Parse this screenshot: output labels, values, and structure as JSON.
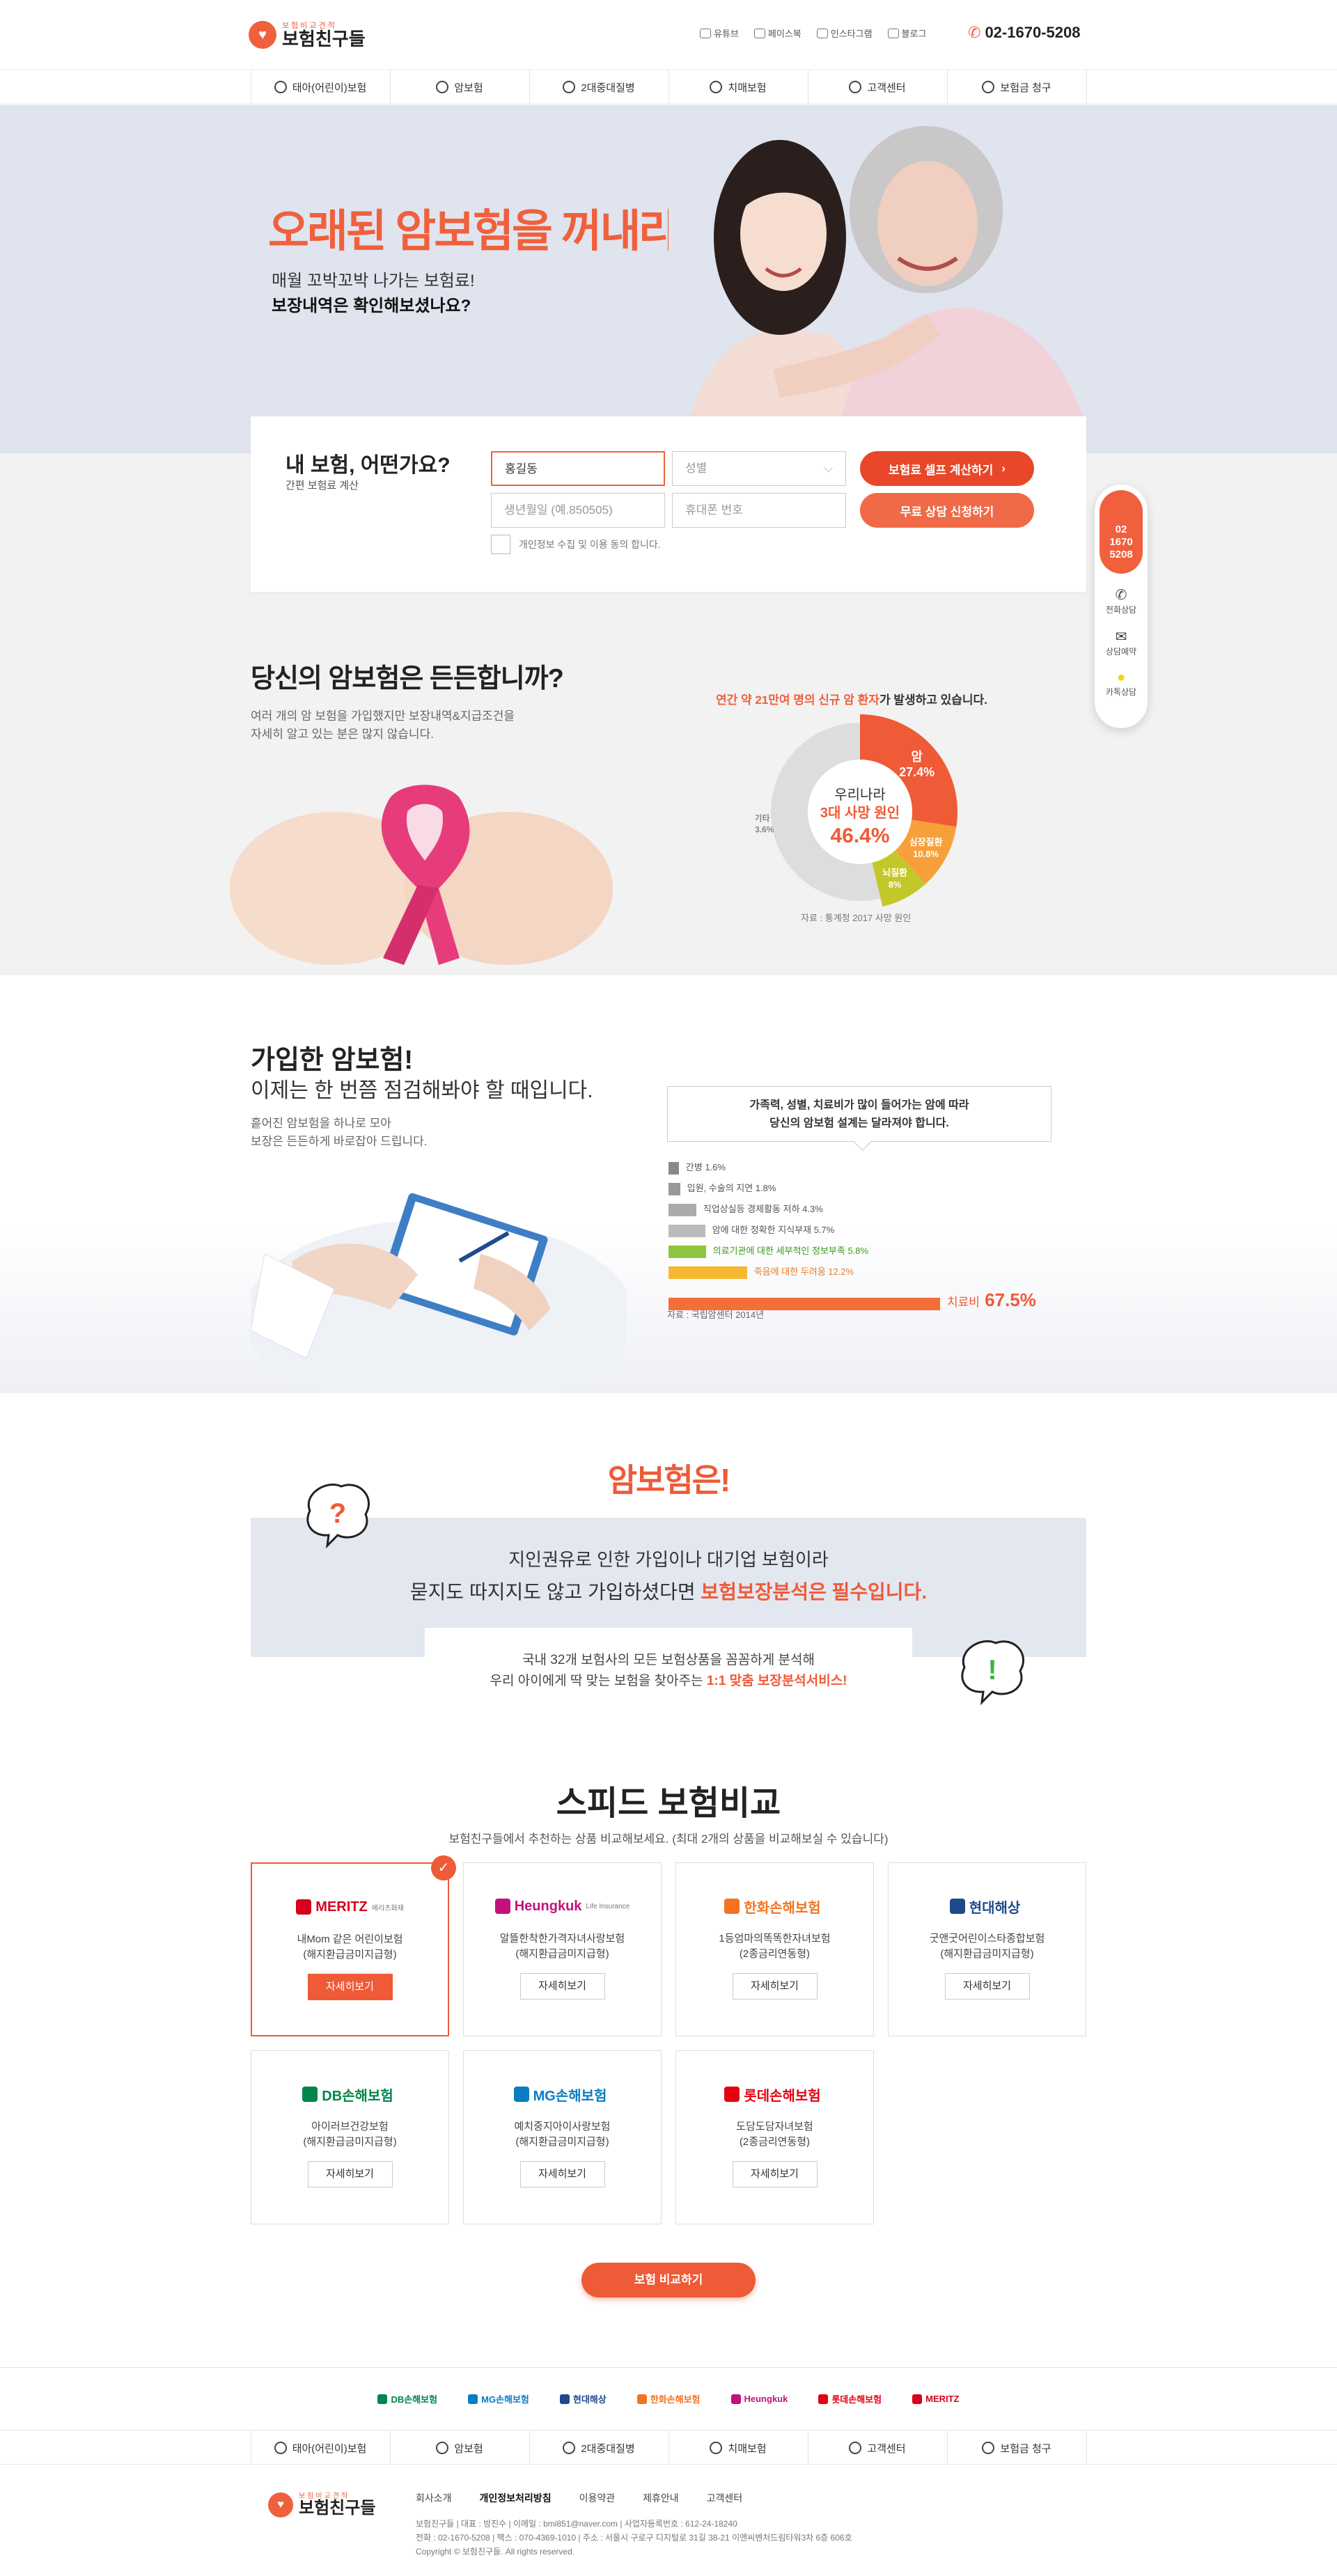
{
  "header": {
    "logo_small": "보험비교견적",
    "logo_text": "보험친구들",
    "sns": [
      {
        "label": "유튜브",
        "icon": "youtube-icon"
      },
      {
        "label": "페이스북",
        "icon": "facebook-icon"
      },
      {
        "label": "인스타그램",
        "icon": "instagram-icon"
      },
      {
        "label": "블로그",
        "icon": "blog-icon"
      }
    ],
    "phone": "02-1670-5208"
  },
  "nav": [
    {
      "label": "태아(어린이)보험",
      "icon": "baby-icon"
    },
    {
      "label": "암보험",
      "icon": "virus-icon"
    },
    {
      "label": "2대중대질병",
      "icon": "pen-icon"
    },
    {
      "label": "치매보험",
      "icon": "elderly-icon"
    },
    {
      "label": "고객센터",
      "icon": "headset-icon"
    },
    {
      "label": "보험금 청구",
      "icon": "won-icon"
    }
  ],
  "hero": {
    "title": "오래된 암보험을 꺼내라!",
    "line1": "매월 꼬박꼬박 나가는 보험료!",
    "line2": "보장내역은 확인해보셨나요?"
  },
  "calc": {
    "title": "내 보험, 어떤가요?",
    "subtitle": "간편 보험료 계산",
    "name_value": "홍길동",
    "gender_placeholder": "성별",
    "birth_placeholder": "생년월일 (예.850505)",
    "phone_placeholder": "휴대폰 번호",
    "calc_button": "보험료 셀프 계산하기",
    "consult_button": "무료 상담 신청하기",
    "agree_text": "개인정보 수집 및 이용 동의 합니다."
  },
  "quick": {
    "tel_lines": [
      "02",
      "1670",
      "5208"
    ],
    "items": [
      "전화상담",
      "상담예약",
      "카톡상담"
    ]
  },
  "section2": {
    "title": "당신의 암보험은 든든합니까?",
    "desc1": "여러 개의 암 보험을 가입했지만 보장내역&지급조건을",
    "desc2": "자세히 알고 있는 분은 많지 않습니다.",
    "pie_title_hl": "연간 약 21만여 명의 신규 암 환자",
    "pie_title_rest": "가 발생하고 있습니다.",
    "pie_center1": "우리나라",
    "pie_center2": "3대 사망 원인",
    "pie_center3": "46.4",
    "pie_center3_unit": "%",
    "source": "자료 : 통계청 2017 사망 원인"
  },
  "chart_data": {
    "type": "pie",
    "title": "연간 약 21만여 명의 신규 암 환자가 발생하고 있습니다.",
    "slices": [
      {
        "name": "암",
        "value": 27.4,
        "color": "#ef5a37"
      },
      {
        "name": "심장질환",
        "value": 10.8,
        "color": "#f7a03a"
      },
      {
        "name": "뇌질환",
        "value": 8,
        "color": "#c3c82a"
      },
      {
        "name": "기타",
        "value": 53.6,
        "color": "#dddddd"
      }
    ]
  },
  "section3": {
    "title": "가입한 암보험!",
    "subtitle": "이제는 한 번쯤 점검해봐야 할 때입니다.",
    "desc1": "흩어진 암보험을 하나로 모아",
    "desc2": "보장은 든든하게 바로잡아 드립니다.",
    "box1": "가족력, 성별, 치료비가 많이 들어가는 암에 따라",
    "box2": "당신의 암보험 설계는 달라져야 합니다.",
    "bars": [
      {
        "label": "간병 1.6%",
        "value": 1.6,
        "color": "#888888"
      },
      {
        "label": "입원, 수술의 지연 1.8%",
        "value": 1.8,
        "color": "#999999"
      },
      {
        "label": "직업상실등 경제활동 저하 4.3%",
        "value": 4.3,
        "color": "#aaaaaa"
      },
      {
        "label": "암에 대한 정확한 지식부재 5.7%",
        "value": 5.7,
        "color": "#bbbbbb"
      },
      {
        "label": "의료기관에 대한 세부적인 정보부족 5.8%",
        "value": 5.8,
        "color": "#8cc63f"
      },
      {
        "label": "죽음에 대한 두려움 12.2%",
        "value": 12.2,
        "color": "#f7b731"
      },
      {
        "label": "치료비",
        "value": 67.5,
        "color": "#f26f3a"
      }
    ],
    "last_pct": "67.5",
    "last_unit": "%",
    "source": "자료 : 국립암센터 2014년"
  },
  "section4": {
    "title": "암보험은!",
    "line1": "지인권유로 인한 가입이나 대기업 보험이라",
    "line2a": "묻지도 따지지도 않고 가입하셨다면 ",
    "line2b": "보험보장분석은 필수입니다.",
    "line3": "국내 32개 보험사의 모든 보험상품을 꼼꼼하게 분석해",
    "line4a": "우리 아이에게 딱 맞는 보험을 찾아주는 ",
    "line4b": "1:1 맞춤 보장분석서비스!"
  },
  "section5": {
    "title": "스피드 보험비교",
    "subtitle": "보험친구들에서 추천하는 상품 비교해보세요. (최대 2개의 상품을 비교해보실 수 있습니다)",
    "detail_label": "자세히보기",
    "compare_button": "보험 비교하기",
    "cards": [
      {
        "brand": "MERITZ",
        "brand_sub": "메리츠화재",
        "color": "#d6001c",
        "name1": "내Mom 같은 어린이보험",
        "name2": "(해지환급금미지급형)"
      },
      {
        "brand": "Heungkuk",
        "brand_sub": "Life Insurance",
        "color": "#c3127d",
        "name1": "알뜰한착한가격자녀사랑보험",
        "name2": "(해지환급금미지급형)"
      },
      {
        "brand": "한화손해보험",
        "brand_sub": "",
        "color": "#f37321",
        "name1": "1등엄마의똑똑한자녀보험",
        "name2": "(2종금리연동형)"
      },
      {
        "brand": "현대해상",
        "brand_sub": "",
        "color": "#1e4a8c",
        "name1": "굿앤굿어린이스타종합보험",
        "name2": "(해지환급금미지급형)"
      },
      {
        "brand": "DB손해보험",
        "brand_sub": "",
        "color": "#00854a",
        "name1": "아이러브건강보험",
        "name2": "(해지환급금미지급형)"
      },
      {
        "brand": "MG손해보험",
        "brand_sub": "",
        "color": "#0a7cc4",
        "name1": "예치중지아이사랑보험",
        "name2": "(해지환급금미지급형)"
      },
      {
        "brand": "롯데손해보험",
        "brand_sub": "",
        "color": "#e60012",
        "name1": "도담도담자녀보험",
        "name2": "(2종금리연동형)"
      }
    ]
  },
  "footer": {
    "logos": [
      "DB손해보험",
      "MG손해보험",
      "현대해상",
      "한화손해보험",
      "Heungkuk",
      "롯데손해보험",
      "MERITZ"
    ],
    "menu": [
      "회사소개",
      "개인정보처리방침",
      "이용약관",
      "제휴안내",
      "고객센터"
    ],
    "addr1": "보험친구들  |  대표 : 방진수  |  이메일 : bmi851@naver.com  |  사업자등록번호 : 612-24-18240",
    "addr2": "전화 : 02-1670-5208  |  팩스 : 070-4369-1010  |  주소 : 서울시 구로구 디지털로 31길 38-21 이앤씨벤처드림타워3차 6층 606호",
    "copy": "Copyright © 보험친구들. All rights reserved."
  }
}
